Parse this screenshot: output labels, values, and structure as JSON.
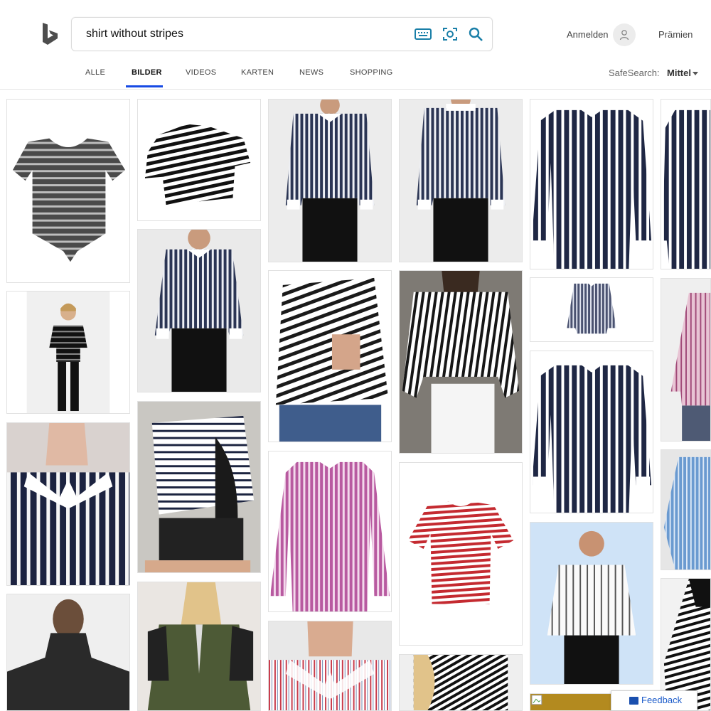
{
  "search": {
    "query": "shirt without stripes"
  },
  "account": {
    "signin_label": "Anmelden",
    "rewards_label": "Prämien"
  },
  "tabs": [
    {
      "label": "ALLE"
    },
    {
      "label": "BILDER"
    },
    {
      "label": "VIDEOS"
    },
    {
      "label": "KARTEN"
    },
    {
      "label": "NEWS"
    },
    {
      "label": "SHOPPING"
    }
  ],
  "active_tab": "BILDER",
  "safesearch": {
    "label": "SafeSearch:",
    "value": "Mittel"
  },
  "feedback": {
    "label": "Feedback"
  },
  "colors": {
    "accent": "#174ae4",
    "icon_teal": "#1a7fa8",
    "link_blue": "#1a5ac9"
  },
  "images": [
    {
      "subject": "gray striped tie-front tee"
    },
    {
      "subject": "black and white striped tee"
    },
    {
      "subject": "navy striped dress shirt on model"
    },
    {
      "subject": "navy striped dress shirt back view"
    },
    {
      "subject": "navy striped shirt white collar"
    },
    {
      "subject": "navy striped shirt partial"
    },
    {
      "subject": "woman in black striped top"
    },
    {
      "subject": "navy striped shirt model"
    },
    {
      "subject": "striped long-sleeve nursing top"
    },
    {
      "subject": "woman in black and white striped blouse"
    },
    {
      "subject": "small striped dress shirt"
    },
    {
      "subject": "pink striped shirt partial"
    },
    {
      "subject": "navy striped shirt collar close-up"
    },
    {
      "subject": "woman in off-shoulder striped top"
    },
    {
      "subject": "pink striped dress shirt"
    },
    {
      "subject": "red striped tee"
    },
    {
      "subject": "navy striped shirt white cuffs"
    },
    {
      "subject": "blue striped shirt partial"
    },
    {
      "subject": "man in black zip jacket"
    },
    {
      "subject": "woman in olive tee with striped sleeves"
    },
    {
      "subject": "white red striped shirt collar"
    },
    {
      "subject": "woman in striped lace-up top"
    },
    {
      "subject": "man in white striped band-collar shirt"
    },
    {
      "subject": "woman in black white striped jacket"
    },
    {
      "subject": "broken image"
    }
  ]
}
